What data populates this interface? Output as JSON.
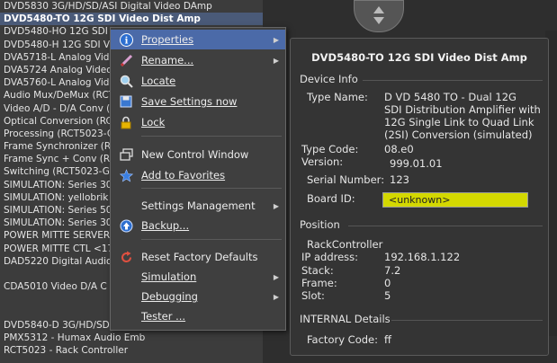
{
  "device_list": [
    "DVD5830 3G/HD/SD/ASI Digital Video DAmp",
    "DVD5480-TO 12G SDI Video Dist Amp",
    "DVD5480-HO 12G SDI Video Dist Amp",
    "DVD5480-H 12G SDI Video Dist Amp",
    "DVA5718-L Analog Video Dist Amp",
    "DVA5724 Analog Video Dist Amp",
    "DVA5760-L Analog Video Dist Amp",
    "Audio Mux/DeMux (RCT5023-G)",
    "Video A/D - D/A Conv (RCT5023-G)",
    "Optical Conversion (RCT5023-G)",
    "Processing (RCT5023-G)",
    "Frame Synchronizer (RCT5023-G)",
    "Frame Sync + Conv (RCT5023-G)",
    "Switching (RCT5023-G) <",
    "SIMULATION: Series 300",
    "SIMULATION: yellobrik",
    "SIMULATION: Series 500",
    "SIMULATION: Series 300",
    "POWER MITTE SERVER <172.",
    "POWER MITTE CTL <172.",
    "DAD5220 Digital Audio",
    "",
    "CDA5010 Video D/A C",
    "",
    "",
    "DVD5840-D 3G/HD/SD FrameSync",
    "PMX5312 - Humax Audio Emb",
    "RCT5023 - Rack Controller"
  ],
  "menu": {
    "properties": "Properties",
    "rename": "Rename...",
    "locate": "Locate",
    "save_settings": "Save Settings now",
    "lock": "Lock",
    "new_window": "New Control Window",
    "add_favorites": "Add to Favorites",
    "settings_mgmt": "Settings Management",
    "backup": "Backup...",
    "reset": "Reset Factory Defaults",
    "simulation": "Simulation",
    "debugging": "Debugging",
    "tester": "Tester ..."
  },
  "panel": {
    "title": "DVD5480-TO 12G SDI Video Dist Amp",
    "device_info": "Device Info",
    "type_name_label": "Type Name:",
    "type_name_l1": "D VD 5480 TO - Dual 12G",
    "type_name_l2": "SDI Distribution Amplifier with",
    "type_name_l3": "12G Single Link to Quad Link",
    "type_name_l4": "(2SI) Conversion (simulated)",
    "type_code_label": "Type Code:",
    "type_code": "08.e0",
    "version_label": "Version:",
    "version": "999.01.01",
    "serial_label": "Serial Number:",
    "serial": "123",
    "board_label": "Board ID:",
    "board": "<unknown>",
    "position": "Position",
    "rack": "RackController",
    "ip_label": "IP address:",
    "ip": "192.168.1.122",
    "stack_label": "Stack:",
    "stack": "7.2",
    "frame_label": "Frame:",
    "frame": "0",
    "slot_label": "Slot:",
    "slot": "5",
    "internal": "INTERNAL Details",
    "factory_label": "Factory Code:",
    "factory": "ff"
  },
  "colors": {
    "highlight": "#4b6aa8",
    "badge": "#d4d800"
  }
}
